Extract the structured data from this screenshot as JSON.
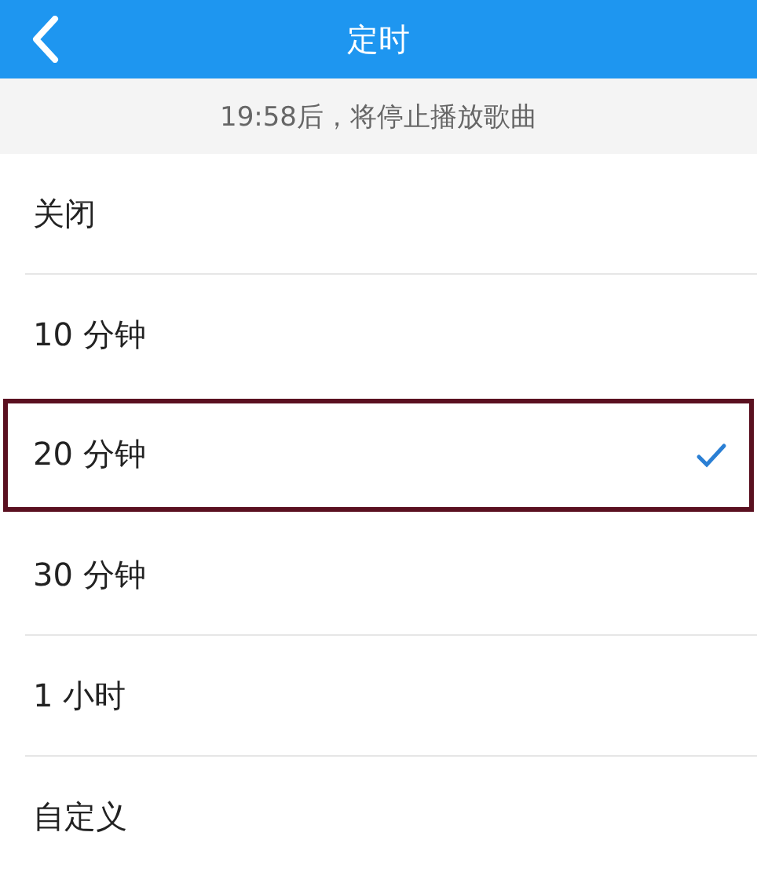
{
  "header": {
    "title": "定时"
  },
  "notice": "19:58后，将停止播放歌曲",
  "options": [
    {
      "label": "关闭",
      "selected": false
    },
    {
      "label": "10 分钟",
      "selected": false
    },
    {
      "label": "20 分钟",
      "selected": true
    },
    {
      "label": "30 分钟",
      "selected": false
    },
    {
      "label": "1 小时",
      "selected": false
    },
    {
      "label": "自定义",
      "selected": false
    }
  ]
}
